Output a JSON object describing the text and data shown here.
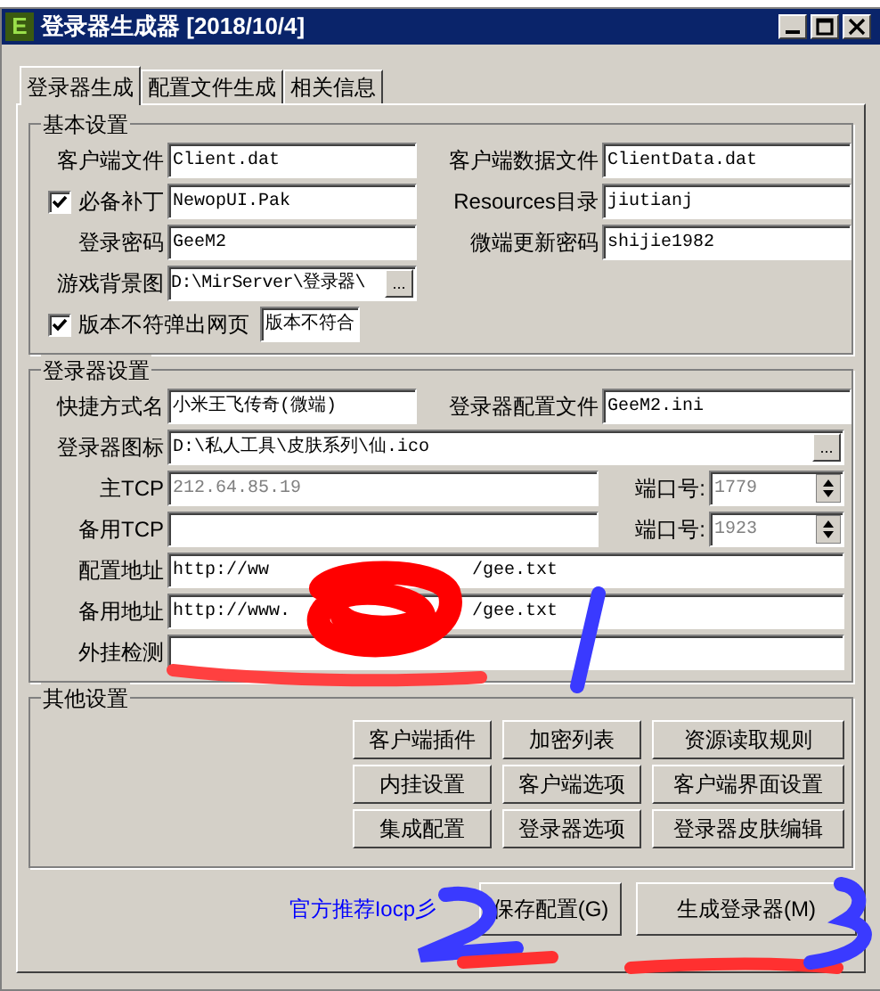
{
  "window": {
    "title": "登录器生成器 [2018/10/4]",
    "icon_letter": "E"
  },
  "tabs": [
    {
      "label": "登录器生成",
      "selected": true
    },
    {
      "label": "配置文件生成",
      "selected": false
    },
    {
      "label": "相关信息",
      "selected": false
    }
  ],
  "basic": {
    "title": "基本设置",
    "rows": [
      [
        {
          "kind": "text",
          "label": "客户端文件",
          "value": "Client.dat"
        },
        {
          "kind": "text",
          "label": "客户端数据文件",
          "value": "ClientData.dat"
        }
      ],
      [
        {
          "kind": "check",
          "label": "必备补丁",
          "checked": true,
          "value": "NewopUI.Pak"
        },
        {
          "kind": "text",
          "label": "Resources目录",
          "value": "jiutianj"
        }
      ],
      [
        {
          "kind": "text",
          "label": "登录密码",
          "value": "GeeM2"
        },
        {
          "kind": "text",
          "label": "微端更新密码",
          "value": "shijie1982"
        }
      ],
      [
        {
          "kind": "browse",
          "label": "游戏背景图",
          "value": "D:\\MirServer\\登录器\\",
          "button": "..."
        }
      ],
      [
        {
          "kind": "check_wide",
          "label": "版本不符弹出网页",
          "checked": true,
          "value": "版本不符合"
        }
      ]
    ]
  },
  "login": {
    "title": "登录器设置",
    "rows": [
      [
        {
          "kind": "text",
          "label": "快捷方式名",
          "value": "小米王飞传奇(微端)"
        },
        {
          "kind": "text",
          "label": "登录器配置文件",
          "value": "GeeM2.ini"
        }
      ],
      [
        {
          "kind": "browse_wide",
          "label": "登录器图标",
          "value": "D:\\私人工具\\皮肤系列\\仙.ico",
          "button": "..."
        }
      ],
      [
        {
          "kind": "tcp",
          "label": "主TCP",
          "value": "212.64.85.19",
          "disabled": true,
          "port_label": "端口号:",
          "port": "1779"
        }
      ],
      [
        {
          "kind": "tcp",
          "label": "备用TCP",
          "disabled": true,
          "port_label": "端口号:",
          "port": "1923"
        }
      ],
      [
        {
          "kind": "wide",
          "label": "配置地址",
          "value": "http://ww",
          "value_tail": "/gee.txt"
        }
      ],
      [
        {
          "kind": "wide",
          "label": "备用地址",
          "value": "http://www.",
          "value_tail": "/gee.txt"
        }
      ],
      [
        {
          "kind": "wide",
          "label": "外挂检测"
        }
      ]
    ]
  },
  "other": {
    "title": "其他设置",
    "buttons": [
      "客户端插件",
      "加密列表",
      "资源读取规则",
      "内挂设置",
      "客户端选项",
      "客户端界面设置",
      "集成配置",
      "登录器选项",
      "登录器皮肤编辑"
    ]
  },
  "footer": {
    "link": "官方推荐Iocp彡",
    "buttons": [
      "保存配置(G)",
      "生成登录器(M)"
    ]
  }
}
